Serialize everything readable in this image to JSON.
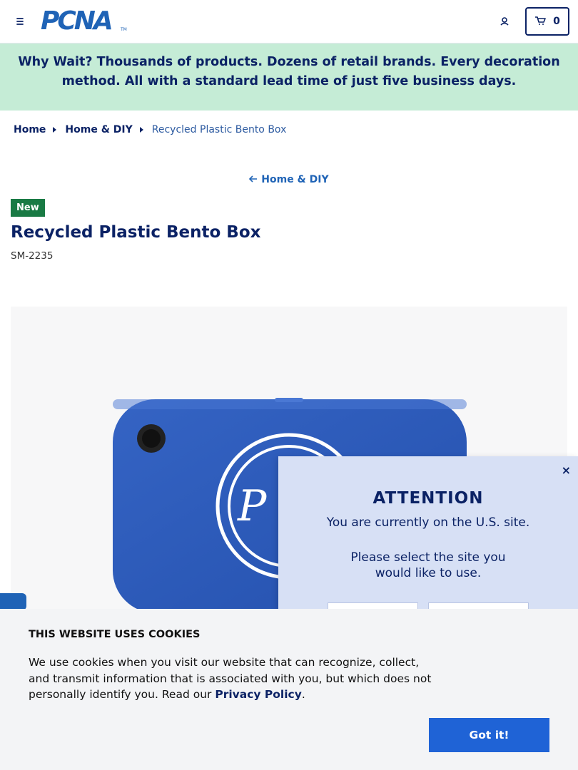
{
  "header": {
    "logo_text": "PCNA",
    "logo_tm": "TM",
    "cart_count": "0"
  },
  "promo": {
    "lead": "Why Wait?",
    "text": "Thousands of products. Dozens of retail brands. Every decoration method. All with a standard lead time of just five business days."
  },
  "breadcrumb": {
    "items": [
      "Home",
      "Home & DIY",
      "Recycled Plastic Bento Box"
    ]
  },
  "back_link": "Home & DIY",
  "product": {
    "badge": "New",
    "title": "Recycled Plastic Bento Box",
    "sku": "SM-2235",
    "image_alt": "Blue recycled plastic bento box with white logo"
  },
  "attention_modal": {
    "close_label": "×",
    "title": "ATTENTION",
    "line1": "You are currently on the U.S. site.",
    "line2": "Please select the site you",
    "line3": "would like to use."
  },
  "cookie_banner": {
    "title": "THIS WEBSITE USES COOKIES",
    "text": "We use cookies when you visit our website that can recognize, collect, and transmit information that is associated with you, but which does not personally identify you. Read our",
    "link": "Privacy Policy",
    "period": ".",
    "button": "Got it!"
  },
  "colors": {
    "navy": "#0b2265",
    "brand_blue": "#1f63b6",
    "promo_bg": "#c5ecd6",
    "badge_green": "#197a44",
    "product_blue": "#2d5fbf"
  }
}
